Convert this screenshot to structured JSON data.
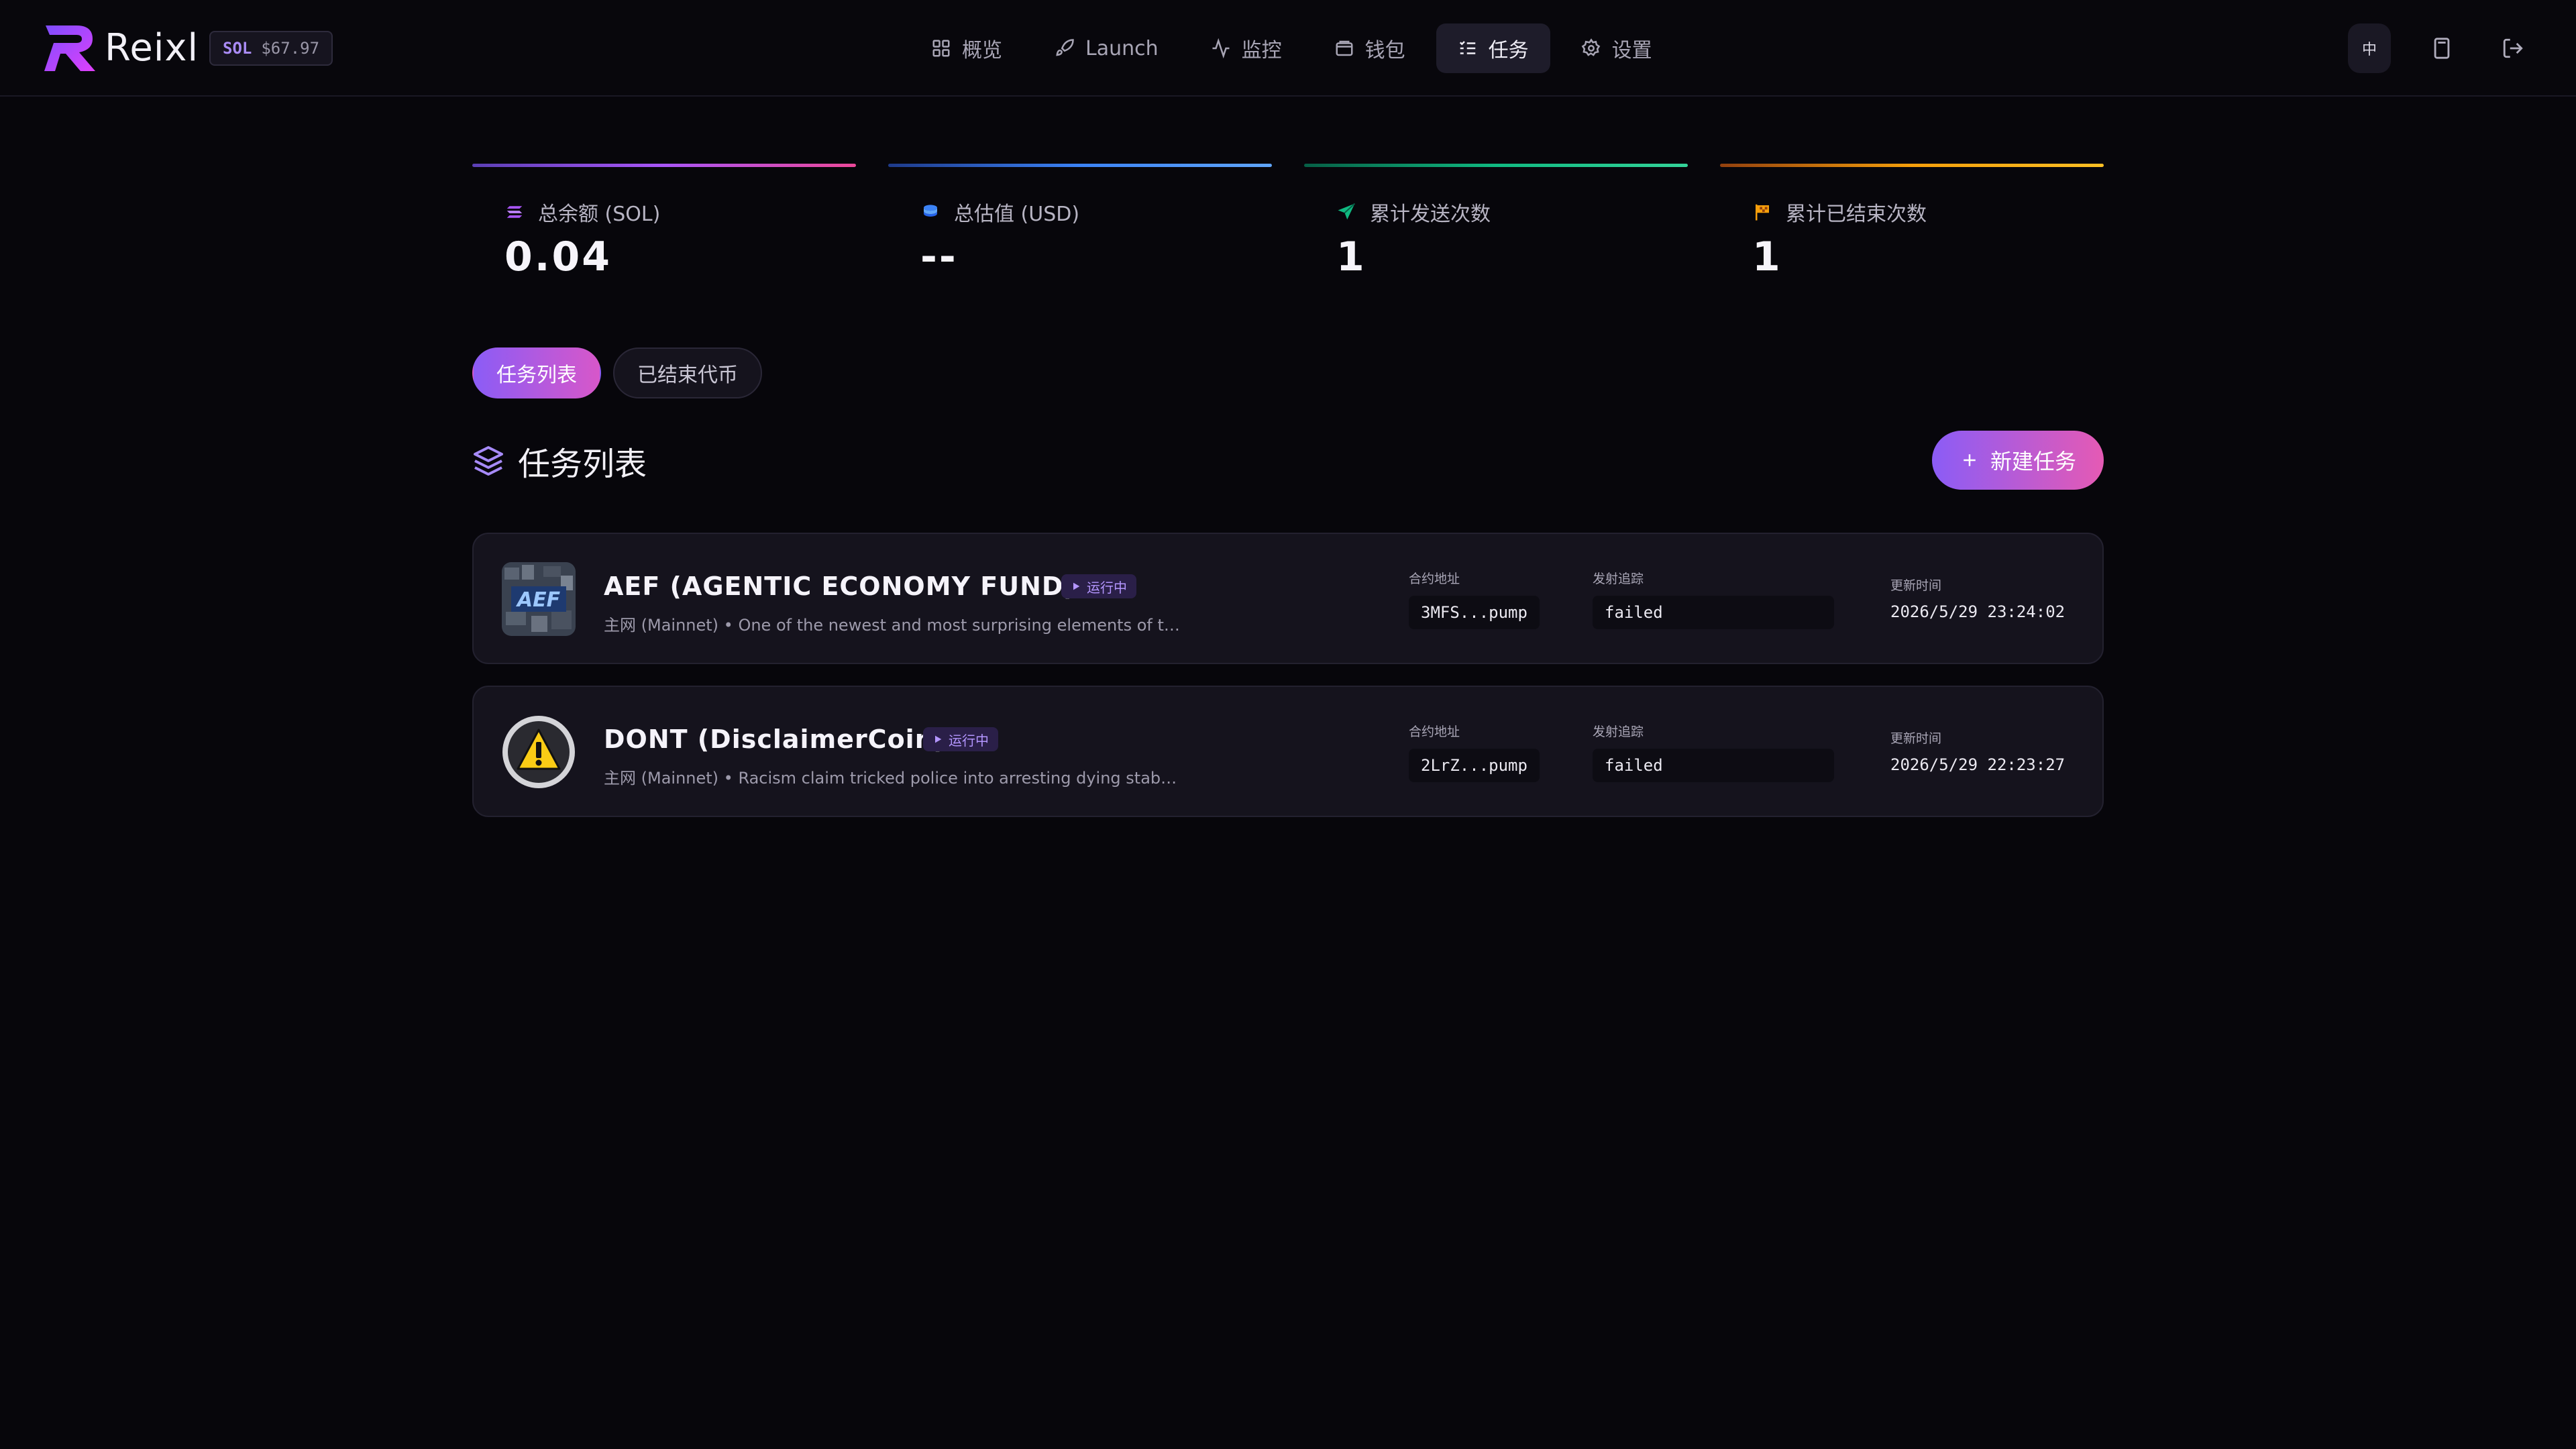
{
  "header": {
    "brand": "Reixl",
    "sol_badge": {
      "symbol": "SOL",
      "price": "$67.97"
    },
    "nav": [
      {
        "label": "概览",
        "icon": "grid-icon"
      },
      {
        "label": "Launch",
        "icon": "rocket-icon"
      },
      {
        "label": "监控",
        "icon": "activity-icon"
      },
      {
        "label": "钱包",
        "icon": "wallet-icon"
      },
      {
        "label": "任务",
        "icon": "list-check-icon",
        "active": true
      },
      {
        "label": "设置",
        "icon": "gear-icon"
      }
    ],
    "lang": "中",
    "right_icons": [
      "calculator-icon",
      "logout-icon"
    ]
  },
  "stats": [
    {
      "label": "总余额 (SOL)",
      "value": "0.04",
      "icon": "solana-icon",
      "accent": "#a855f7"
    },
    {
      "label": "总估值 (USD)",
      "value": "--",
      "icon": "coins-icon",
      "accent": "#3b82f6"
    },
    {
      "label": "累计发送次数",
      "value": "1",
      "icon": "send-icon",
      "accent": "#10b981"
    },
    {
      "label": "累计已结束次数",
      "value": "1",
      "icon": "flag-icon",
      "accent": "#f59e0b"
    }
  ],
  "tabs": [
    {
      "label": "任务列表",
      "active": true
    },
    {
      "label": "已结束代币",
      "active": false
    }
  ],
  "section": {
    "title": "任务列表",
    "new_button": "新建任务"
  },
  "tasks": [
    {
      "name": "AEF (AGENTIC ECONOMY FUND)",
      "status": "运行中",
      "desc": "主网 (Mainnet) • One of the newest and most surprising elements of the Iran peace draft deal...",
      "contract_label": "合约地址",
      "contract": "3MFS...pump",
      "trace_label": "发射追踪",
      "trace": "failed",
      "time_label": "更新时间",
      "time": "2026/5/29 23:24:02"
    },
    {
      "name": "DONT (DisclaimerCoin)",
      "status": "运行中",
      "desc": "主网 (Mainnet) • Racism claim tricked police into arresting dying stabbing victim https://www....",
      "contract_label": "合约地址",
      "contract": "2LrZ...pump",
      "trace_label": "发射追踪",
      "trace": "failed",
      "time_label": "更新时间",
      "time": "2026/5/29 22:23:27"
    }
  ]
}
